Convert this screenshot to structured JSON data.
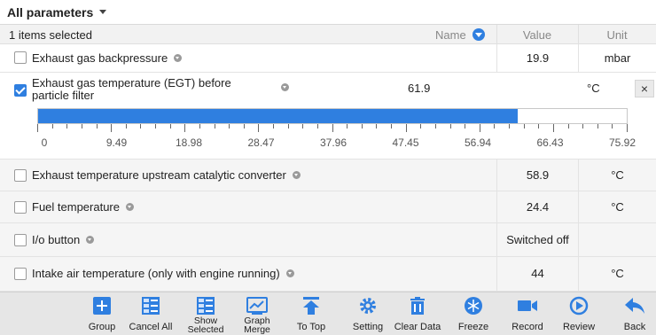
{
  "header": {
    "title": "All parameters"
  },
  "columns": {
    "selected": "1 items selected",
    "name": "Name",
    "value": "Value",
    "unit": "Unit"
  },
  "rows": [
    {
      "label": "Exhaust gas backpressure",
      "value": "19.9",
      "unit": "mbar",
      "checked": false
    },
    {
      "label": "Exhaust temperature upstream catalytic converter",
      "value": "58.9",
      "unit": "°C",
      "checked": false
    },
    {
      "label": "Fuel temperature",
      "value": "24.4",
      "unit": "°C",
      "checked": false
    },
    {
      "label": "I/o button",
      "value": "Switched off",
      "unit": "",
      "checked": false
    },
    {
      "label": "Intake air temperature (only with engine running)",
      "value": "44",
      "unit": "°C",
      "checked": false
    }
  ],
  "expanded": {
    "label": "Exhaust gas temperature (EGT) before particle filter",
    "value": "61.9",
    "unit": "°C",
    "close": "×",
    "gauge": {
      "min": 0,
      "max": 75.92,
      "value": 61.9,
      "fraction": 0.815
    },
    "ticks": [
      "0",
      "9.49",
      "18.98",
      "28.47",
      "37.96",
      "47.45",
      "56.94",
      "66.43",
      "75.92"
    ]
  },
  "toolbar": [
    {
      "label": "Group",
      "icon": "plus-square-icon"
    },
    {
      "label": "Cancel All",
      "icon": "checklist-x-icon"
    },
    {
      "label": "Show Selected",
      "icon": "checklist-check-icon"
    },
    {
      "label": "Graph Merge",
      "icon": "line-chart-icon"
    },
    {
      "label": "To Top",
      "icon": "arrow-up-bar-icon"
    },
    {
      "label": "Setting",
      "icon": "gear-icon"
    },
    {
      "label": "Clear Data",
      "icon": "trash-icon"
    },
    {
      "label": "Freeze",
      "icon": "snowflake-icon"
    },
    {
      "label": "Record",
      "icon": "video-camera-icon"
    },
    {
      "label": "Review",
      "icon": "play-circle-icon"
    },
    {
      "label": "Back",
      "icon": "back-arrow-icon"
    }
  ],
  "colors": {
    "accent": "#2f7fe0",
    "toolbar": "#e6e6e6"
  }
}
